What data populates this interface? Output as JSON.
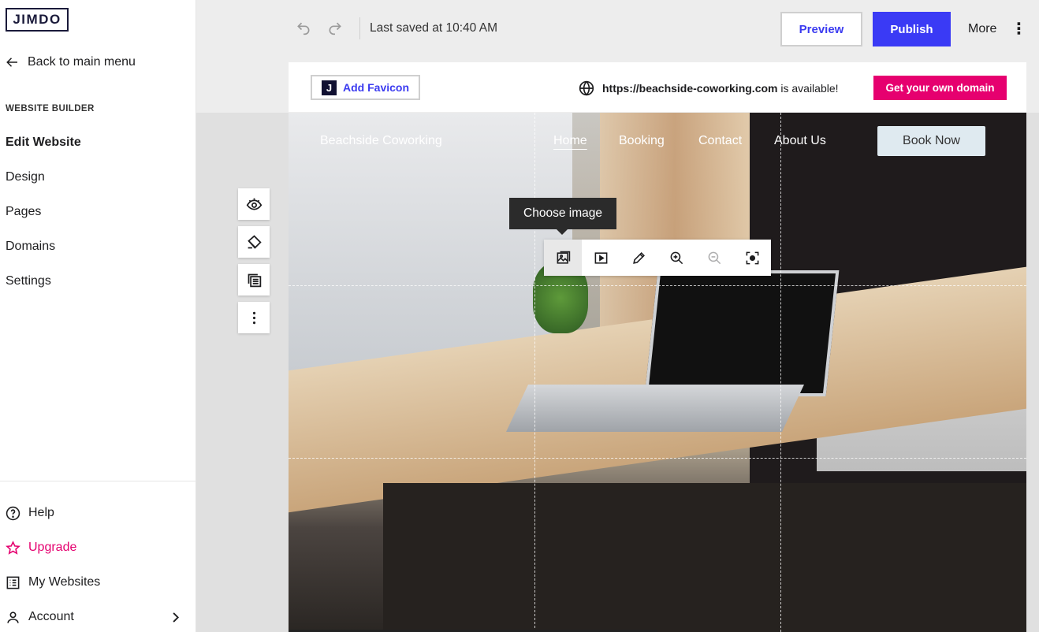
{
  "app": {
    "logo_text": "JIMDO"
  },
  "sidebar": {
    "back_label": "Back to main menu",
    "section_title": "WEBSITE BUILDER",
    "items": [
      {
        "label": "Edit Website",
        "active": true
      },
      {
        "label": "Design"
      },
      {
        "label": "Pages"
      },
      {
        "label": "Domains"
      },
      {
        "label": "Settings"
      }
    ],
    "bottom_items": [
      {
        "label": "Help",
        "icon": "help-icon"
      },
      {
        "label": "Upgrade",
        "icon": "star-icon",
        "color": "#e5006f"
      },
      {
        "label": "My Websites",
        "icon": "list-icon"
      },
      {
        "label": "Account",
        "icon": "user-icon"
      }
    ]
  },
  "topbar": {
    "saved_text": "Last saved at 10:40 AM",
    "preview_label": "Preview",
    "publish_label": "Publish",
    "more_label": "More"
  },
  "domain_bar": {
    "favicon_label": "Add Favicon",
    "favicon_letter": "J",
    "domain_name": "https://beachside-coworking.com",
    "domain_suffix": "is available!",
    "cta_label": "Get your own domain"
  },
  "site": {
    "brand": "Beachside Coworking",
    "nav": [
      "Home",
      "Booking",
      "Contact",
      "About Us"
    ],
    "book_label": "Book Now"
  },
  "image_toolbar": {
    "tooltip": "Choose image",
    "tools": [
      "choose-image-icon",
      "video-icon",
      "edit-icon",
      "zoom-in-icon",
      "zoom-out-icon",
      "focus-icon"
    ]
  },
  "colors": {
    "accent": "#3a3af5",
    "brand_pink": "#e6006f",
    "logo_dark": "#1a1a3a"
  }
}
